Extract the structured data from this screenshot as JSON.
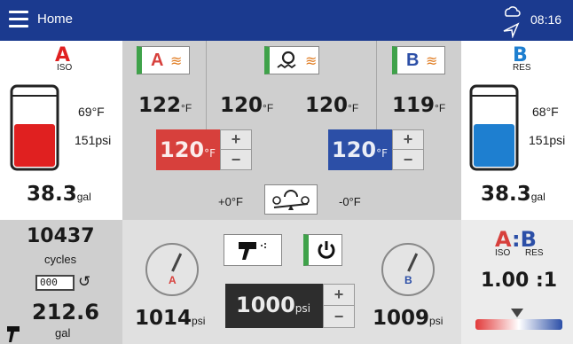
{
  "header": {
    "title": "Home",
    "time": "08:16"
  },
  "side_a": {
    "letter": "A",
    "sub": "ISO",
    "temp": "69°F",
    "pressure": "151",
    "pressure_unit": "psi",
    "volume": "38.3",
    "volume_unit": "gal",
    "fill_fraction": 0.55,
    "color": "#e02020"
  },
  "side_b": {
    "letter": "B",
    "sub": "RES",
    "temp": "68°F",
    "pressure": "151",
    "pressure_unit": "psi",
    "volume": "38.3",
    "volume_unit": "gal",
    "fill_fraction": 0.55,
    "color": "#1e7fd0"
  },
  "heaters": {
    "a_label": "A",
    "b_label": "B",
    "a_temp": "122",
    "hose_temp": "120",
    "hose_temp2": "120",
    "b_temp": "119",
    "unit": "°F",
    "a_setpoint": "120",
    "b_setpoint": "120",
    "a_offset": "+0°F",
    "b_offset": "-0°F"
  },
  "counters": {
    "cycles": "10437",
    "cycles_label": "cycles",
    "odometer": "000",
    "gallons": "212.6",
    "gallons_label": "gal"
  },
  "pump": {
    "a_pressure": "1014",
    "b_pressure": "1009",
    "unit": "psi",
    "setpoint": "1000",
    "a_label": "A",
    "b_label": "B"
  },
  "ratio": {
    "a": "A",
    "b": "B",
    "a_sub": "ISO",
    "b_sub": "RES",
    "value": "1.00 :1"
  },
  "colors": {
    "header": "#1b3a8f",
    "a": "#d7403c",
    "b": "#2c4fa7",
    "on": "#3fa24a"
  }
}
